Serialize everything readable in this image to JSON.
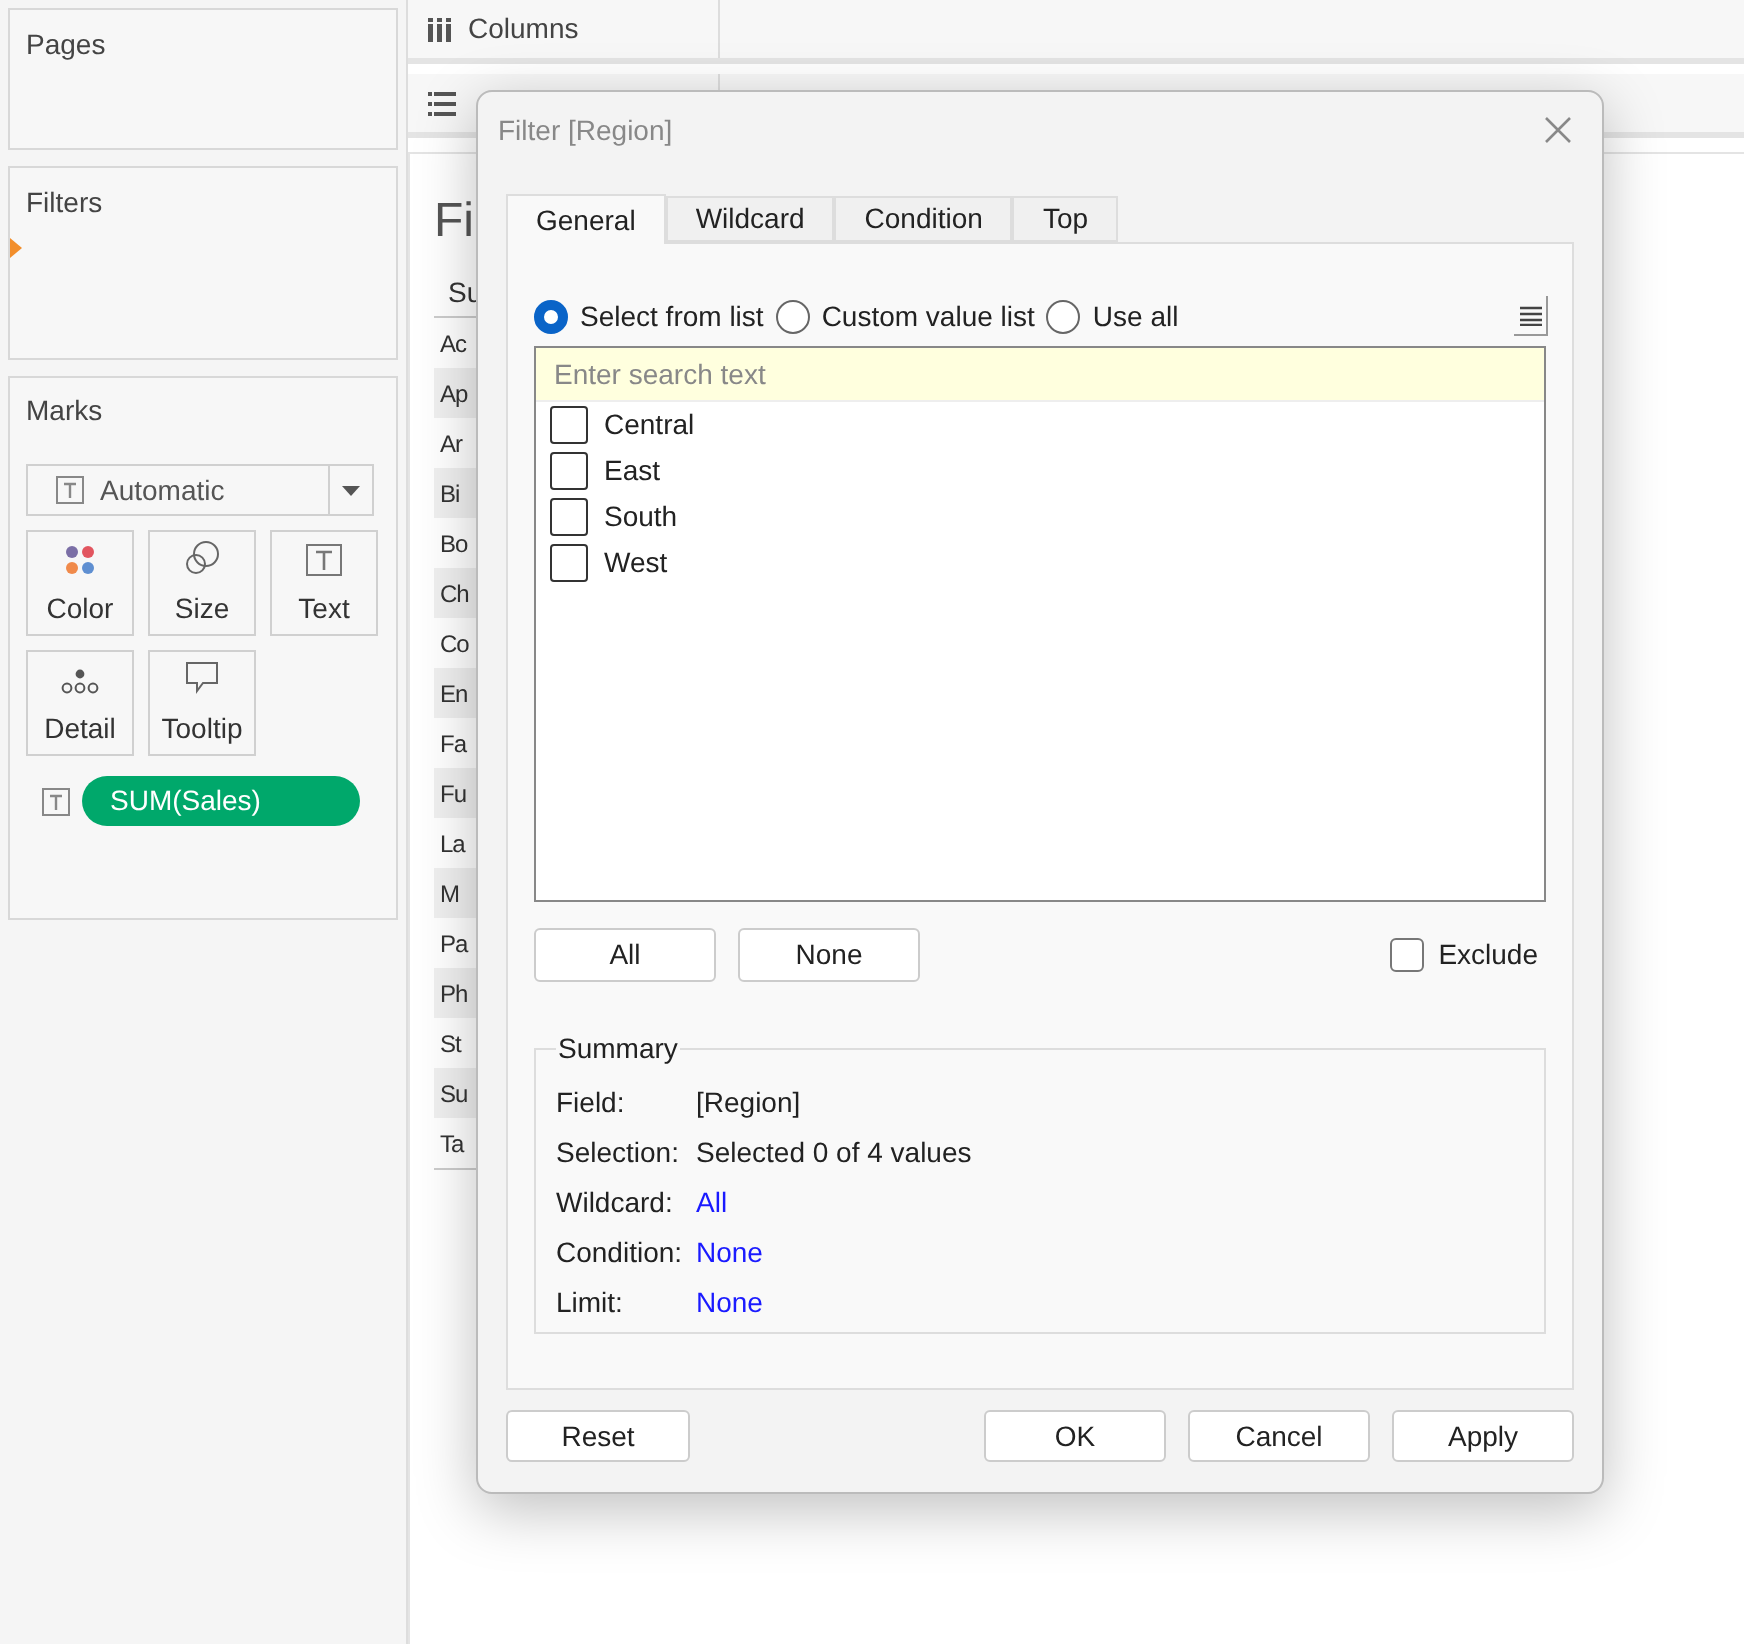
{
  "pages_card": {
    "title": "Pages"
  },
  "filters_card": {
    "title": "Filters"
  },
  "marks_card": {
    "title": "Marks",
    "mark_type": "Automatic",
    "buttons": [
      {
        "kind": "color",
        "label": "Color"
      },
      {
        "kind": "size",
        "label": "Size"
      },
      {
        "kind": "text",
        "label": "Text"
      },
      {
        "kind": "detail",
        "label": "Detail"
      },
      {
        "kind": "tooltip",
        "label": "Tooltip"
      }
    ],
    "pills": [
      {
        "label": "SUM(Sales)"
      }
    ]
  },
  "columns_shelf": {
    "label": "Columns"
  },
  "sheet": {
    "title": "Fi",
    "header": "Su",
    "rows": [
      "Ac",
      "Ap",
      "Ar",
      "Bi",
      "Bo",
      "Ch",
      "Co",
      "En",
      "Fa",
      "Fu",
      "La",
      "M",
      "Pa",
      "Ph",
      "St",
      "Su",
      "Ta"
    ]
  },
  "dialog": {
    "title": "Filter [Region]",
    "tabs": [
      {
        "label": "General",
        "selected": true
      },
      {
        "label": "Wildcard",
        "selected": false
      },
      {
        "label": "Condition",
        "selected": false
      },
      {
        "label": "Top",
        "selected": false
      }
    ],
    "options": [
      {
        "label": "Select from list",
        "selected": true
      },
      {
        "label": "Custom value list",
        "selected": false
      },
      {
        "label": "Use all",
        "selected": false
      }
    ],
    "search": {
      "placeholder": "Enter search text"
    },
    "values": [
      {
        "label": "Central",
        "checked": false
      },
      {
        "label": "East",
        "checked": false
      },
      {
        "label": "South",
        "checked": false
      },
      {
        "label": "West",
        "checked": false
      }
    ],
    "list_buttons": [
      "All",
      "None"
    ],
    "exclude": {
      "label": "Exclude",
      "checked": false
    },
    "summary": {
      "title": "Summary",
      "rows": [
        {
          "label": "Field:",
          "value": "[Region]",
          "kind": "plain"
        },
        {
          "label": "Selection:",
          "value": "Selected 0 of 4 values",
          "kind": "plain"
        },
        {
          "label": "Wildcard:",
          "value": "All",
          "kind": "link"
        },
        {
          "label": "Condition:",
          "value": "None",
          "kind": "link"
        },
        {
          "label": "Limit:",
          "value": "None",
          "kind": "link"
        }
      ]
    },
    "footer_left": "Reset",
    "footer_buttons": [
      "OK",
      "Cancel",
      "Apply"
    ]
  }
}
